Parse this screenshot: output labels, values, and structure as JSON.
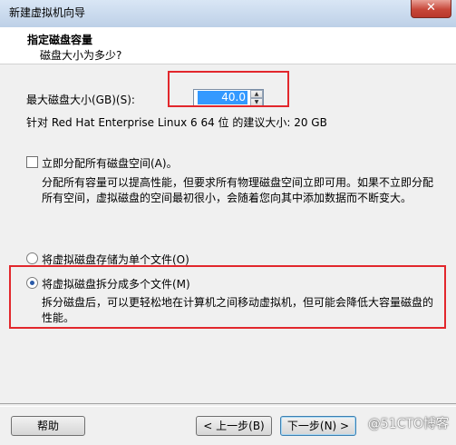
{
  "window": {
    "title": "新建虚拟机向导",
    "close_glyph": "✕"
  },
  "header": {
    "title": "指定磁盘容量",
    "subtitle": "磁盘大小为多少?"
  },
  "disk_size": {
    "label": "最大磁盘大小(GB)(S):",
    "value": "40.0",
    "recommendation": "针对 Red Hat Enterprise Linux 6 64 位 的建议大小: 20 GB"
  },
  "allocate": {
    "label": "立即分配所有磁盘空间(A)。",
    "checked": false,
    "description_line1": "分配所有容量可以提高性能，但要求所有物理磁盘空间立即可用。如果不立即分配",
    "description_line2": "所有空间，虚拟磁盘的空间最初很小，会随着您向其中添加数据而不断变大。"
  },
  "options": {
    "single_file": {
      "label": "将虚拟磁盘存储为单个文件(O)",
      "selected": false
    },
    "multiple_files": {
      "label": "将虚拟磁盘拆分成多个文件(M)",
      "selected": true,
      "description_line1": "拆分磁盘后，可以更轻松地在计算机之间移动虚拟机，但可能会降低大容量磁盘的",
      "description_line2": "性能。"
    }
  },
  "buttons": {
    "help": "帮助",
    "back": "< 上一步(B)",
    "next": "下一步(N) >"
  },
  "watermark": "@51CTO博客",
  "colors": {
    "annotation_red": "#e2272c",
    "selection_blue": "#3399ff"
  }
}
